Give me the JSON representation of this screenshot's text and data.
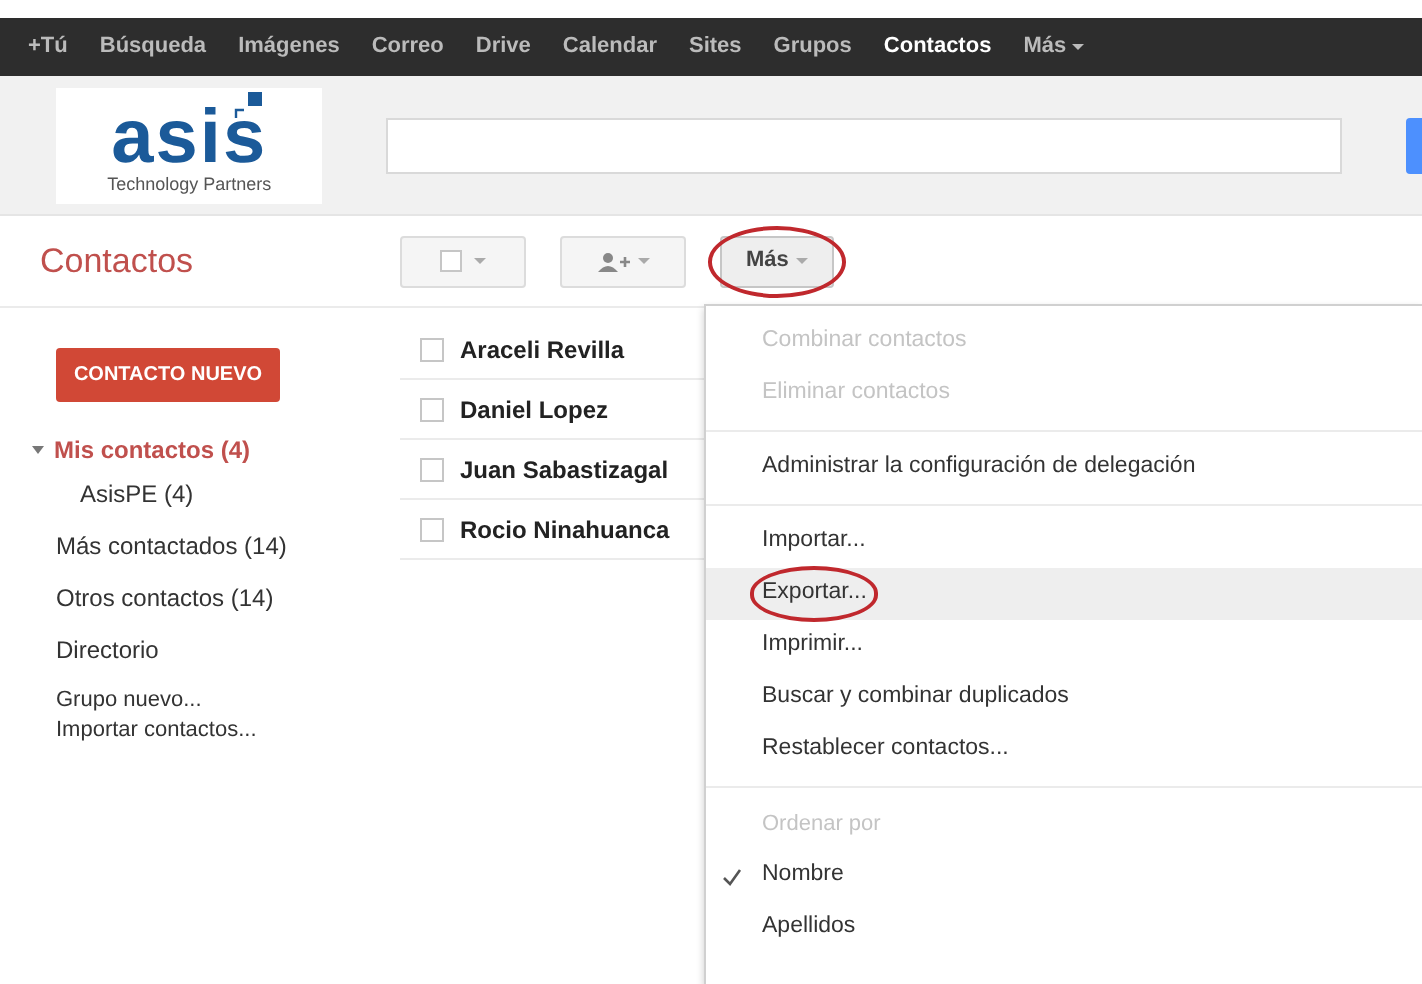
{
  "topbar": {
    "items": [
      {
        "label": "+Tú",
        "selected": false
      },
      {
        "label": "Búsqueda",
        "selected": false
      },
      {
        "label": "Imágenes",
        "selected": false
      },
      {
        "label": "Correo",
        "selected": false
      },
      {
        "label": "Drive",
        "selected": false
      },
      {
        "label": "Calendar",
        "selected": false
      },
      {
        "label": "Sites",
        "selected": false
      },
      {
        "label": "Grupos",
        "selected": false
      },
      {
        "label": "Contactos",
        "selected": true
      },
      {
        "label": "Más",
        "selected": false,
        "dropdown": true
      }
    ]
  },
  "logo": {
    "text": "asis",
    "tagline": "Technology Partners"
  },
  "page_title": "Contactos",
  "toolbar": {
    "more_button": {
      "label": "Más",
      "circled": true
    }
  },
  "new_contact_button": "CONTACTO NUEVO",
  "sidebar": {
    "items": [
      {
        "label": "Mis contactos (4)",
        "selected": true,
        "expanded": true,
        "children": [
          {
            "label": "AsisPE (4)",
            "selected": false
          }
        ]
      },
      {
        "label": "Más contactados (14)",
        "selected": false
      },
      {
        "label": "Otros contactos (14)",
        "selected": false
      },
      {
        "label": "Directorio",
        "selected": false
      }
    ],
    "actions": [
      "Grupo nuevo...",
      "Importar contactos..."
    ]
  },
  "contacts": [
    {
      "name": "Araceli Revilla",
      "checked": false
    },
    {
      "name": "Daniel Lopez",
      "checked": false
    },
    {
      "name": "Juan Sabastizagal",
      "checked": false
    },
    {
      "name": "Rocio Ninahuanca",
      "checked": false
    }
  ],
  "menu": {
    "groups": [
      {
        "items": [
          {
            "label": "Combinar contactos",
            "disabled": true,
            "highlighted": false,
            "circled": false
          },
          {
            "label": "Eliminar contactos",
            "disabled": true,
            "highlighted": false,
            "circled": false
          }
        ]
      },
      {
        "items": [
          {
            "label": "Administrar la configuración de delegación",
            "disabled": false,
            "highlighted": false,
            "circled": false
          }
        ]
      },
      {
        "items": [
          {
            "label": "Importar...",
            "disabled": false,
            "highlighted": false,
            "circled": false
          },
          {
            "label": "Exportar...",
            "disabled": false,
            "highlighted": true,
            "circled": true
          },
          {
            "label": "Imprimir...",
            "disabled": false,
            "highlighted": false,
            "circled": false
          },
          {
            "label": "Buscar y combinar duplicados",
            "disabled": false,
            "highlighted": false,
            "circled": false
          },
          {
            "label": "Restablecer contactos...",
            "disabled": false,
            "highlighted": false,
            "circled": false
          }
        ]
      },
      {
        "heading": "Ordenar por",
        "items": [
          {
            "label": "Nombre",
            "disabled": false,
            "highlighted": false,
            "circled": false,
            "checked": true
          },
          {
            "label": "Apellidos",
            "disabled": false,
            "highlighted": false,
            "circled": false,
            "checked": false
          }
        ]
      }
    ]
  }
}
